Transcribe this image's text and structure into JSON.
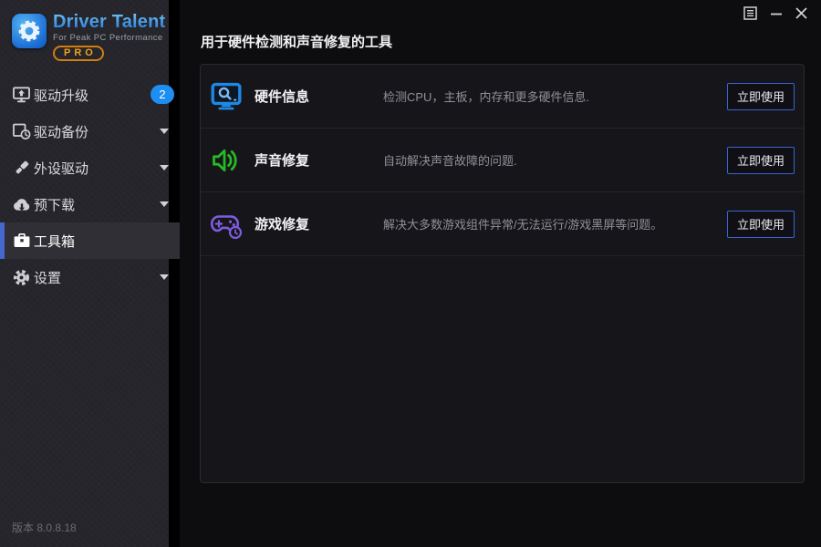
{
  "logo": {
    "title": "Driver Talent",
    "subtitle": "For Peak PC Performance",
    "badge": "PRO"
  },
  "sidebar": {
    "items": [
      {
        "label": "驱动升级",
        "icon": "monitor-upgrade-icon",
        "badge": "2",
        "active": false
      },
      {
        "label": "驱动备份",
        "icon": "backup-clock-icon",
        "expandable": true,
        "active": false
      },
      {
        "label": "外设驱动",
        "icon": "usb-drive-icon",
        "expandable": true,
        "active": false
      },
      {
        "label": "预下载",
        "icon": "cloud-download-icon",
        "expandable": true,
        "active": false
      },
      {
        "label": "工具箱",
        "icon": "toolbox-icon",
        "active": true
      },
      {
        "label": "设置",
        "icon": "gear-icon",
        "expandable": true,
        "active": false
      }
    ],
    "version": "版本 8.0.8.18"
  },
  "window": {
    "controls": [
      {
        "name": "menu",
        "icon": "menu-list-icon"
      },
      {
        "name": "minimize",
        "icon": "minimize-icon"
      },
      {
        "name": "close",
        "icon": "close-icon"
      }
    ]
  },
  "main": {
    "title": "用于硬件检测和声音修复的工具",
    "tools": [
      {
        "name": "硬件信息",
        "description": "检测CPU，主板，内存和更多硬件信息.",
        "icon": "hardware-monitor-search-icon",
        "icon_color": "#1e88e5",
        "action": "立即使用"
      },
      {
        "name": "声音修复",
        "description": "自动解决声音故障的问题.",
        "icon": "speaker-sound-icon",
        "icon_color": "#27b827",
        "action": "立即使用"
      },
      {
        "name": "游戏修复",
        "description": "解决大多数游戏组件异常/无法运行/游戏黑屏等问题。",
        "icon": "gamepad-repair-icon",
        "icon_color": "#7e5be0",
        "action": "立即使用"
      }
    ]
  },
  "colors": {
    "accent_blue": "#1e88e5",
    "badge_blue": "#1d8ff2",
    "sound_green": "#27b827",
    "game_purple": "#7e5be0",
    "button_border": "#3a62d8",
    "active_item_bar": "#4667cd",
    "pro_orange": "#f2a21c",
    "logo_blue": "#2f9be9",
    "sidebar_bg": "#25252b",
    "card_bg": "#16161a"
  }
}
